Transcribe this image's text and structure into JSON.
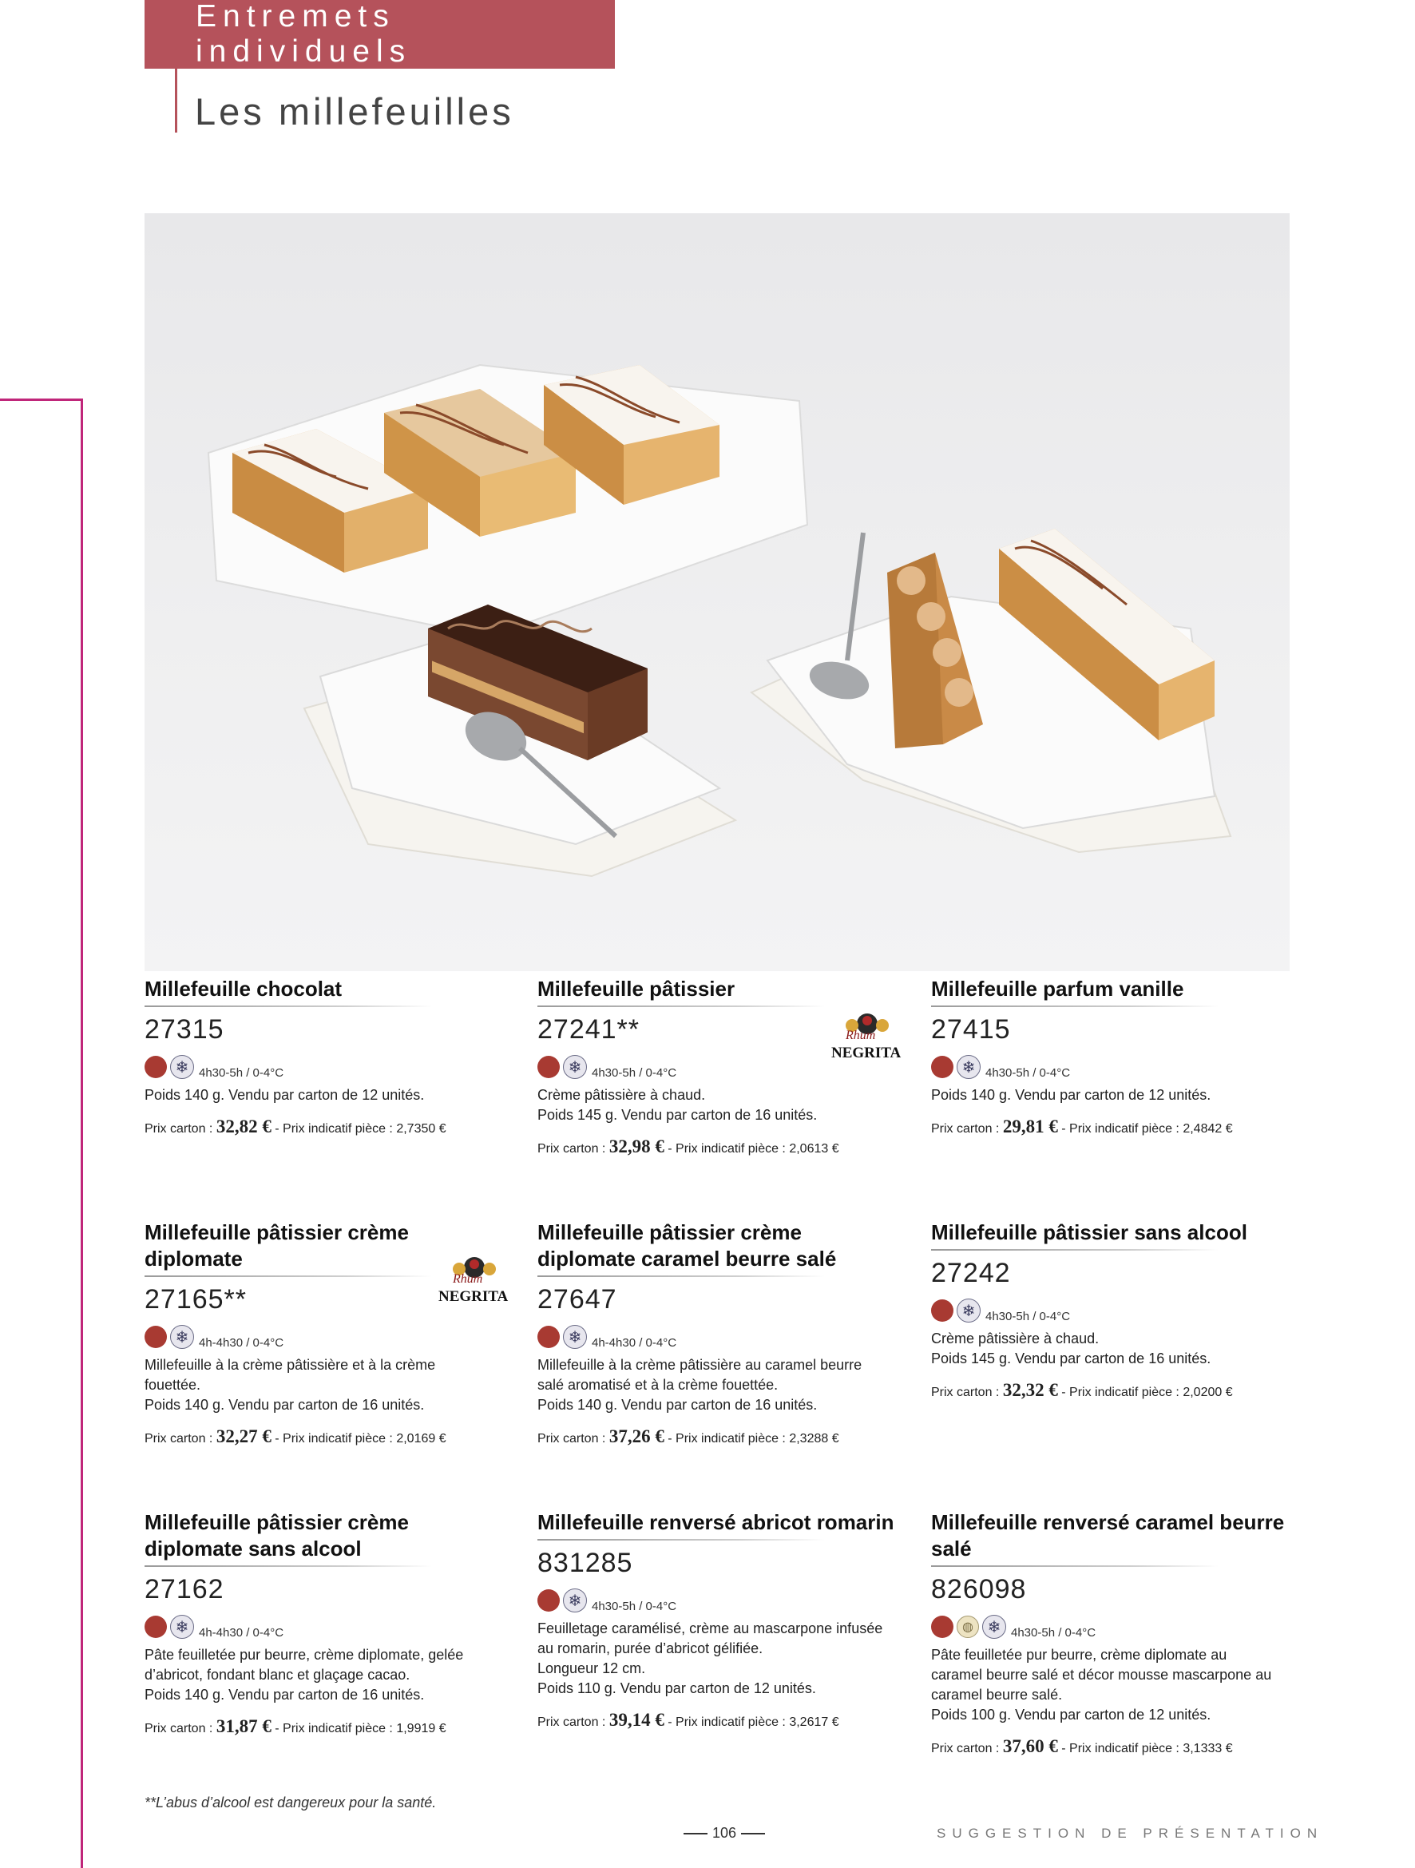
{
  "header": {
    "category": "Entremets individuels",
    "section_title": "Les millefeuilles"
  },
  "colors": {
    "brand": "#b5525b",
    "margin_line": "#c0267a",
    "icon_red": "#a83a32"
  },
  "products": [
    {
      "name": "Millefeuille chocolat",
      "code": "27315",
      "icons": [
        "dessert-red-icon",
        "frozen-icon"
      ],
      "thaw": "4h30-5h / 0-4°C",
      "description": "Poids 140 g. Vendu par carton de 12 unités.",
      "price_label": "Prix carton :",
      "price_carton": "32,82 €",
      "price_piece": "- Prix indicatif pièce : 2,7350 €"
    },
    {
      "name": "Millefeuille pâtissier",
      "code": "27241**",
      "icons": [
        "dessert-red-icon",
        "frozen-icon"
      ],
      "thaw": "4h30-5h / 0-4°C",
      "description": "Crème pâtissière à chaud.\nPoids 145 g. Vendu par carton de 16 unités.",
      "price_label": "Prix carton :",
      "price_carton": "32,98 €",
      "price_piece": "- Prix indicatif pièce : 2,0613 €",
      "logo": {
        "script": "Rhum",
        "name": "NEGRITA"
      }
    },
    {
      "name": "Millefeuille parfum vanille",
      "code": "27415",
      "icons": [
        "dessert-red-icon",
        "frozen-icon"
      ],
      "thaw": "4h30-5h / 0-4°C",
      "description": "Poids 140 g. Vendu par carton de 12 unités.",
      "price_label": "Prix carton :",
      "price_carton": "29,81 €",
      "price_piece": "- Prix indicatif pièce : 2,4842 €"
    },
    {
      "name": "Millefeuille pâtissier crème diplomate",
      "code": "27165**",
      "icons": [
        "dessert-red-icon",
        "frozen-icon"
      ],
      "thaw": "4h-4h30 / 0-4°C",
      "description": "Millefeuille à la crème pâtissière et à la crème\nfouettée.\nPoids 140 g. Vendu par carton de 16 unités.",
      "price_label": "Prix carton :",
      "price_carton": "32,27 €",
      "price_piece": "- Prix indicatif pièce : 2,0169 €",
      "logo": {
        "script": "Rhum",
        "name": "NEGRITA"
      }
    },
    {
      "name": "Millefeuille pâtissier crème diplomate caramel beurre salé",
      "code": "27647",
      "icons": [
        "dessert-red-icon",
        "frozen-icon"
      ],
      "thaw": "4h-4h30 / 0-4°C",
      "description": "Millefeuille à la crème pâtissière au caramel beurre\nsalé aromatisé et à la crème fouettée.\nPoids 140 g. Vendu par carton de 16 unités.",
      "price_label": "Prix carton :",
      "price_carton": "37,26 €",
      "price_piece": "- Prix indicatif pièce : 2,3288 €"
    },
    {
      "name": "Millefeuille pâtissier sans alcool",
      "code": "27242",
      "icons": [
        "dessert-red-icon",
        "frozen-icon"
      ],
      "thaw": "4h30-5h / 0-4°C",
      "description": "Crème pâtissière à chaud.\nPoids 145 g. Vendu par carton de 16 unités.",
      "price_label": "Prix carton :",
      "price_carton": "32,32 €",
      "price_piece": "- Prix indicatif pièce : 2,0200 €"
    },
    {
      "name": "Millefeuille pâtissier crème diplomate sans alcool",
      "code": "27162",
      "icons": [
        "dessert-red-icon",
        "frozen-icon"
      ],
      "thaw": "4h-4h30 / 0-4°C",
      "description": "Pâte feuilletée pur beurre, crème diplomate, gelée\nd’abricot, fondant blanc et glaçage cacao.\nPoids 140 g. Vendu par carton de 16 unités.",
      "price_label": "Prix carton :",
      "price_carton": "31,87 €",
      "price_piece": "- Prix indicatif pièce : 1,9919 €"
    },
    {
      "name": "Millefeuille renversé abricot romarin",
      "code": "831285",
      "icons": [
        "dessert-red-icon",
        "frozen-icon"
      ],
      "thaw": "4h30-5h / 0-4°C",
      "description": "Feuilletage caramélisé, crème au mascarpone infusée\nau romarin, purée d’abricot gélifiée.\nLongueur 12 cm.\nPoids 110 g. Vendu par carton de 12 unités.",
      "price_label": "Prix carton :",
      "price_carton": "39,14 €",
      "price_piece": "- Prix indicatif pièce : 3,2617 €"
    },
    {
      "name": "Millefeuille renversé caramel beurre salé",
      "code": "826098",
      "icons": [
        "dessert-red-icon",
        "cream-icon",
        "frozen-icon"
      ],
      "thaw": "4h30-5h / 0-4°C",
      "description": "Pâte feuilletée pur beurre, crème diplomate au\ncaramel beurre salé et décor mousse mascarpone au\ncaramel beurre salé.\nPoids 100 g. Vendu par carton de 12 unités.",
      "price_label": "Prix carton :",
      "price_carton": "37,60 €",
      "price_piece": "- Prix indicatif pièce : 3,1333 €"
    }
  ],
  "footer": {
    "footnote": "**L’abus d’alcool est dangereux pour la santé.",
    "page_number": "106",
    "suggestion": "SUGGESTION DE PRÉSENTATION"
  }
}
